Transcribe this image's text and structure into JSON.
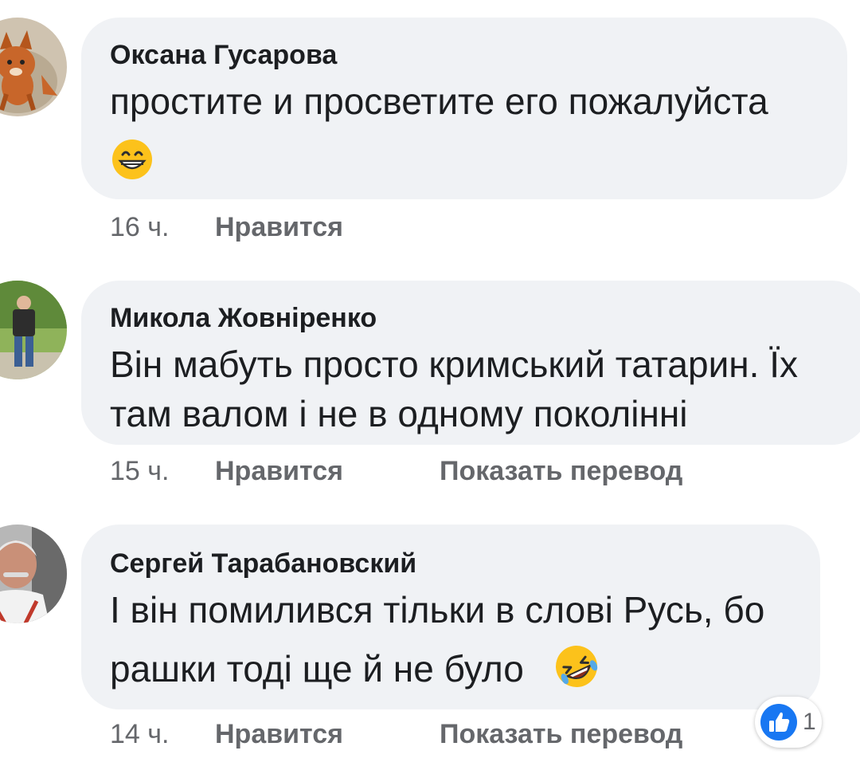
{
  "comments": [
    {
      "author": "Оксана Гусарова",
      "line1": "простите  и просветите его пожалуйста",
      "line2": "",
      "emoji": "grinning-face-with-smiling-eyes",
      "time": "16 ч.",
      "like_label": "Нравится",
      "translate_label": ""
    },
    {
      "author": "Микола Жовніренко",
      "line1": "Він мабуть просто кримський татарин. Їх",
      "line2": "там валом і не в одному поколінні",
      "emoji": "",
      "time": "15 ч.",
      "like_label": "Нравится",
      "translate_label": "Показать перевод"
    },
    {
      "author": "Сергей Тарабановский",
      "line1": "І він помилився тільки в слові Русь, бо",
      "line2": "рашки тоді ще й не було",
      "emoji": "rolling-on-the-floor-laughing",
      "time": "14 ч.",
      "like_label": "Нравится",
      "translate_label": "Показать перевод",
      "reaction": {
        "icon": "thumbs-up-icon",
        "count": "1"
      }
    }
  ],
  "colors": {
    "bubble": "#f0f2f5",
    "meta_text": "#65676b",
    "like_blue": "#1877f2",
    "emoji_yellow": "#fcc21b"
  }
}
